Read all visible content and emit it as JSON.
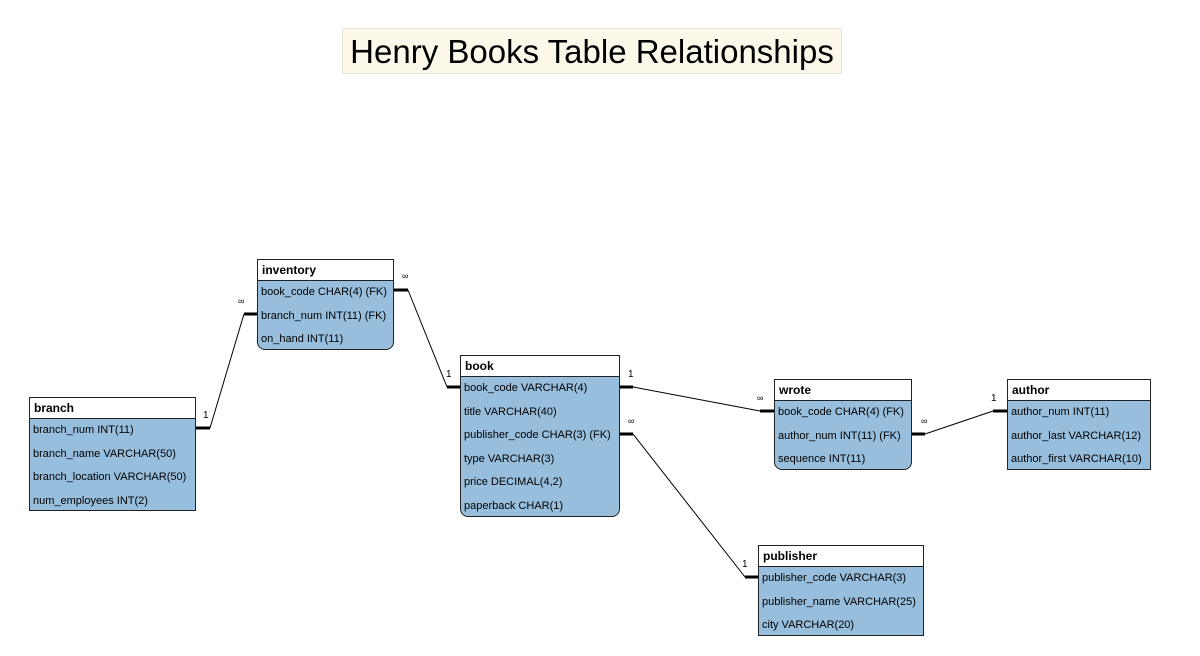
{
  "title": "Henry Books Table Relationships",
  "entities": {
    "inventory": {
      "name": "inventory",
      "fields": [
        "book_code CHAR(4) (FK)",
        "branch_num INT(11) (FK)",
        "on_hand INT(11)"
      ]
    },
    "branch": {
      "name": "branch",
      "fields": [
        "branch_num INT(11)",
        "branch_name VARCHAR(50)",
        "branch_location VARCHAR(50)",
        "num_employees INT(2)"
      ]
    },
    "book": {
      "name": "book",
      "fields": [
        "book_code VARCHAR(4)",
        "title VARCHAR(40)",
        "publisher_code CHAR(3) (FK)",
        "type VARCHAR(3)",
        "price DECIMAL(4,2)",
        "paperback CHAR(1)"
      ]
    },
    "wrote": {
      "name": "wrote",
      "fields": [
        "book_code CHAR(4) (FK)",
        "author_num INT(11) (FK)",
        "sequence INT(11)"
      ]
    },
    "author": {
      "name": "author",
      "fields": [
        "author_num INT(11)",
        "author_last VARCHAR(12)",
        "author_first VARCHAR(10)"
      ]
    },
    "publisher": {
      "name": "publisher",
      "fields": [
        "publisher_code VARCHAR(3)",
        "publisher_name VARCHAR(25)",
        "city VARCHAR(20)"
      ]
    }
  },
  "relationships": [
    {
      "from": "branch.branch_num",
      "to": "inventory.branch_num",
      "from_card": "1",
      "to_card": "∞"
    },
    {
      "from": "book.book_code",
      "to": "inventory.book_code",
      "from_card": "1",
      "to_card": "∞"
    },
    {
      "from": "book.book_code",
      "to": "wrote.book_code",
      "from_card": "1",
      "to_card": "∞"
    },
    {
      "from": "author.author_num",
      "to": "wrote.author_num",
      "from_card": "1",
      "to_card": "∞"
    },
    {
      "from": "publisher.publisher_code",
      "to": "book.publisher_code",
      "from_card": "1",
      "to_card": "∞"
    }
  ]
}
